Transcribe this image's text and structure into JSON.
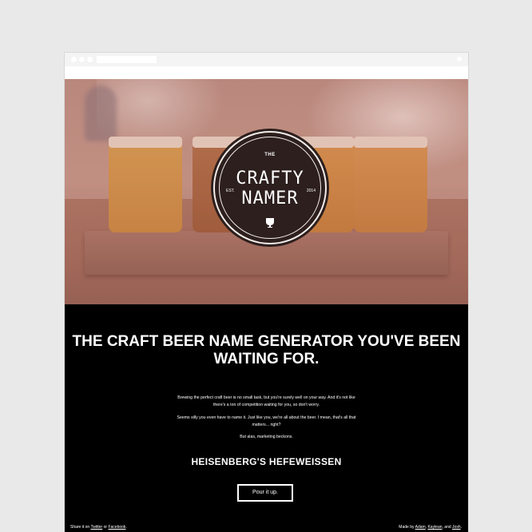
{
  "hero": {
    "badge": {
      "the": "THE",
      "crafty": "CRAFTY",
      "namer": "NAMER",
      "est": "EST.",
      "year": "2014"
    }
  },
  "main": {
    "headline": "THE CRAFT BEER NAME GENERATOR YOU'VE BEEN WAITING FOR.",
    "paragraphs": [
      "Brewing the perfect craft beer is no small task, but you're surely well on your way. And it's not like there's a ton of competition waiting for you, so don't worry.",
      "Seems silly you even have to name it. Just like you, we're all about the beer. I mean, that's all that matters... right?",
      "But alas, marketing beckons."
    ],
    "generated_name": "HEISENBERG'S HEFEWEISSEN",
    "pour_button": "Pour it up."
  },
  "footer": {
    "share_prefix": "Share it on",
    "twitter": "Twitter",
    "or": "or",
    "facebook": "Facebook",
    "period": ".",
    "made_by": "Made by",
    "adam": "Adam",
    "comma": ",",
    "kaylean": "Kaylean",
    "and": ", and",
    "josh": "Josh",
    "period2": "."
  },
  "colors": {
    "page_background": "#e9e9e9",
    "content_background": "#000000",
    "badge_background": "#2c1f1d",
    "text": "#ffffff"
  },
  "icons": {
    "scroll_down": "chevron-down-icon",
    "beer_glass": "beer-glass-icon"
  }
}
